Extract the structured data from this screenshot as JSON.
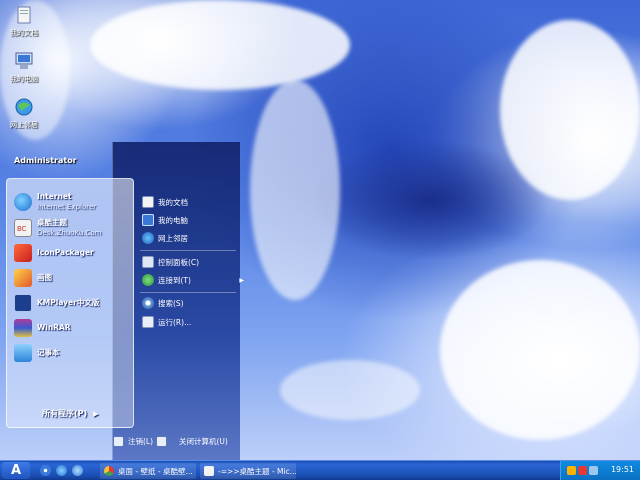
{
  "desktop": {
    "icons": [
      {
        "label": "我的文档"
      },
      {
        "label": "我的电脑"
      },
      {
        "label": "网上邻居"
      }
    ]
  },
  "start_menu": {
    "user": "Administrator",
    "programs": [
      {
        "title": "Internet",
        "subtitle": "Internet Explorer"
      },
      {
        "title": "桌酷主题",
        "subtitle": "Desk.ZhuoKu.Com"
      },
      {
        "title": "IconPackager"
      },
      {
        "title": "画图"
      },
      {
        "title": "KMPlayer中文版"
      },
      {
        "title": "WinRAR"
      },
      {
        "title": "记事本"
      }
    ],
    "all_programs": "所有程序(P)",
    "places": [
      {
        "label": "我的文档"
      },
      {
        "label": "我的电脑"
      },
      {
        "label": "网上邻居"
      },
      {
        "label": "控制面板(C)"
      },
      {
        "label": "连接到(T)"
      },
      {
        "label": "搜索(S)"
      },
      {
        "label": "运行(R)..."
      }
    ],
    "logoff": "注销(L)",
    "shutdown": "关闭计算机(U)"
  },
  "taskbar": {
    "start_glyph": "A",
    "tasks": [
      {
        "label": "桌面 - 壁纸 - 桌酷壁..."
      },
      {
        "label": "-=>>桌酷主题 - Mic..."
      }
    ],
    "clock": "19:51"
  }
}
